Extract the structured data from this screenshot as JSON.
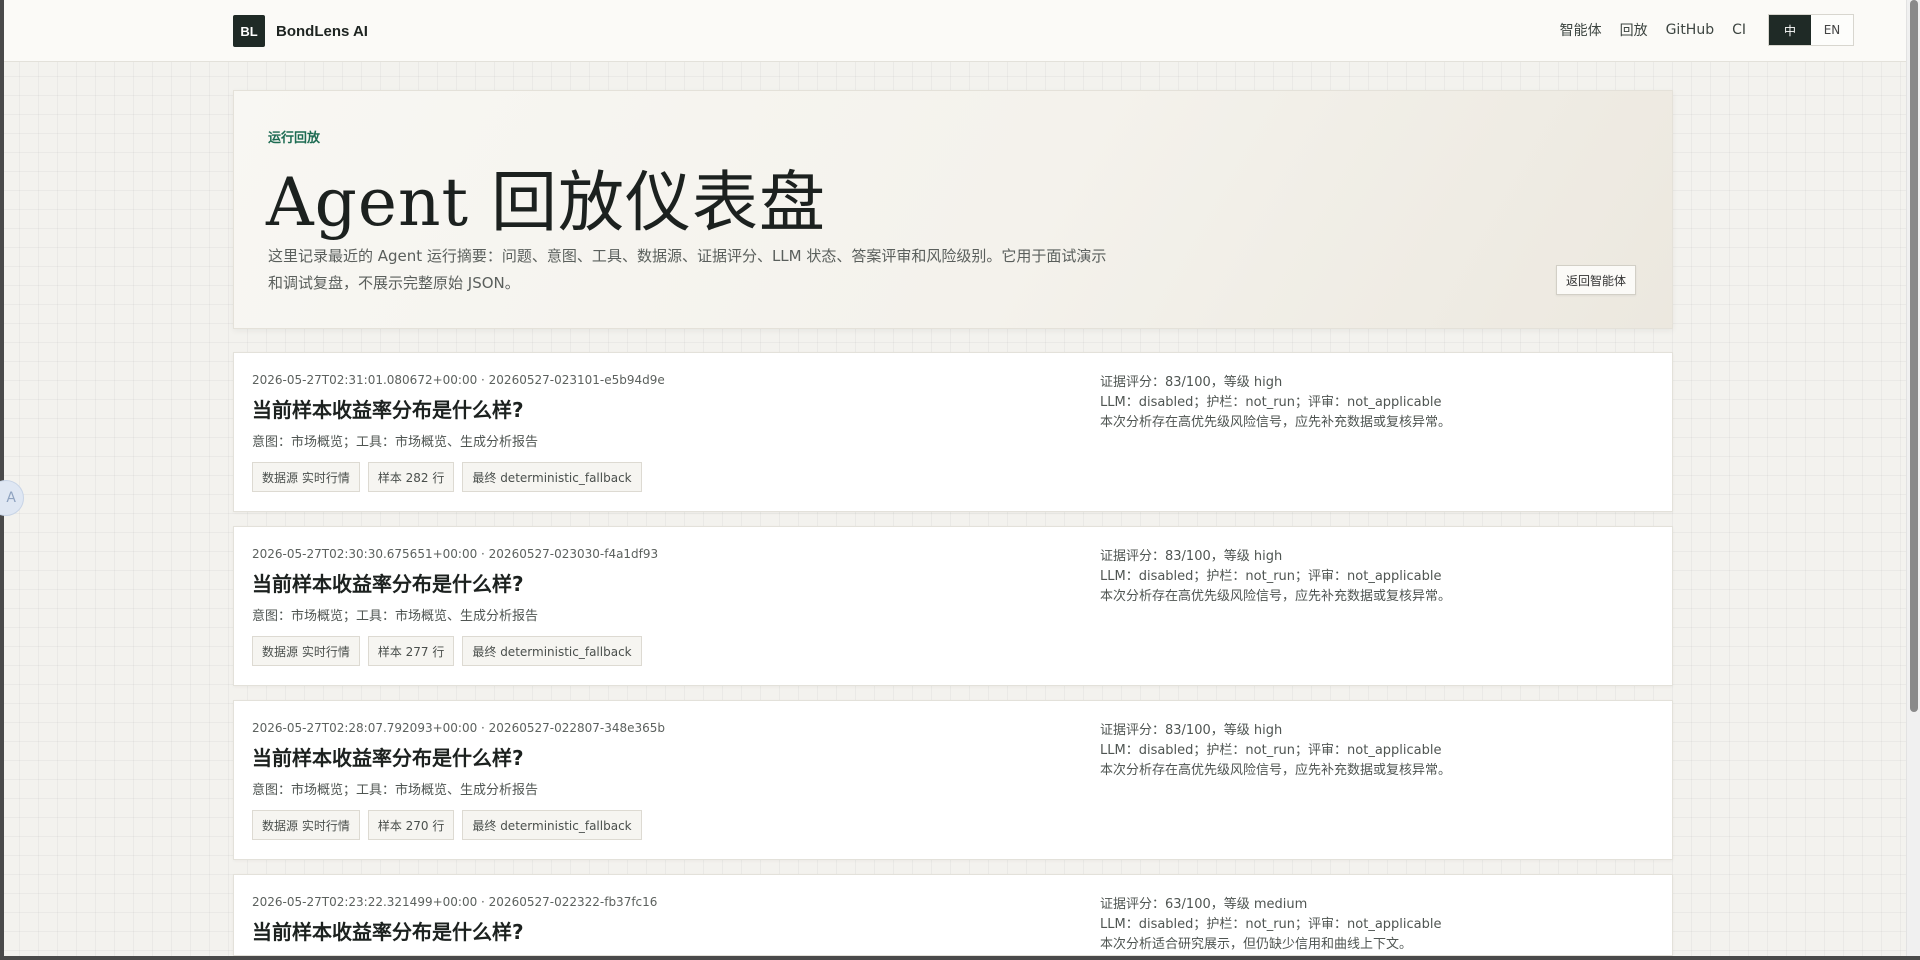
{
  "brand": {
    "logo_text": "BL",
    "name": "BondLens AI"
  },
  "nav": {
    "links": [
      "智能体",
      "回放",
      "GitHub",
      "CI"
    ],
    "lang": {
      "active": "中",
      "other": "EN"
    }
  },
  "hero": {
    "eyebrow": "运行回放",
    "title": "Agent 回放仪表盘",
    "description": "这里记录最近的 Agent 运行摘要：问题、意图、工具、数据源、证据评分、LLM 状态、答案评审和风险级别。它用于面试演示和调试复盘，不展示完整原始 JSON。",
    "back_button": "返回智能体"
  },
  "runs": [
    {
      "meta": "2026-05-27T02:31:01.080672+00:00 · 20260527-023101-e5b94d9e",
      "question": "当前样本收益率分布是什么样?",
      "intent": "意图：市场概览；工具：市场概览、生成分析报告",
      "tags": [
        "数据源 实时行情",
        "样本 282 行",
        "最终 deterministic_fallback"
      ],
      "score": "证据评分：83/100，等级 high",
      "llm": "LLM：disabled；护栏：not_run；评审：not_applicable",
      "note": "本次分析存在高优先级风险信号，应先补充数据或复核异常。"
    },
    {
      "meta": "2026-05-27T02:30:30.675651+00:00 · 20260527-023030-f4a1df93",
      "question": "当前样本收益率分布是什么样?",
      "intent": "意图：市场概览；工具：市场概览、生成分析报告",
      "tags": [
        "数据源 实时行情",
        "样本 277 行",
        "最终 deterministic_fallback"
      ],
      "score": "证据评分：83/100，等级 high",
      "llm": "LLM：disabled；护栏：not_run；评审：not_applicable",
      "note": "本次分析存在高优先级风险信号，应先补充数据或复核异常。"
    },
    {
      "meta": "2026-05-27T02:28:07.792093+00:00 · 20260527-022807-348e365b",
      "question": "当前样本收益率分布是什么样?",
      "intent": "意图：市场概览；工具：市场概览、生成分析报告",
      "tags": [
        "数据源 实时行情",
        "样本 270 行",
        "最终 deterministic_fallback"
      ],
      "score": "证据评分：83/100，等级 high",
      "llm": "LLM：disabled；护栏：not_run；评审：not_applicable",
      "note": "本次分析存在高优先级风险信号，应先补充数据或复核异常。"
    },
    {
      "meta": "2026-05-27T02:23:22.321499+00:00 · 20260527-022322-fb37fc16",
      "question": "当前样本收益率分布是什么样?",
      "intent": "",
      "tags": [],
      "score": "证据评分：63/100，等级 medium",
      "llm": "LLM：disabled；护栏：not_run；评审：not_applicable",
      "note": "本次分析适合研究展示，但仍缺少信用和曲线上下文。"
    }
  ],
  "side_badge": "A",
  "colors": {
    "accent": "#1d6b52",
    "dark": "#1f2a26",
    "page_bg": "#f3f2ee"
  }
}
